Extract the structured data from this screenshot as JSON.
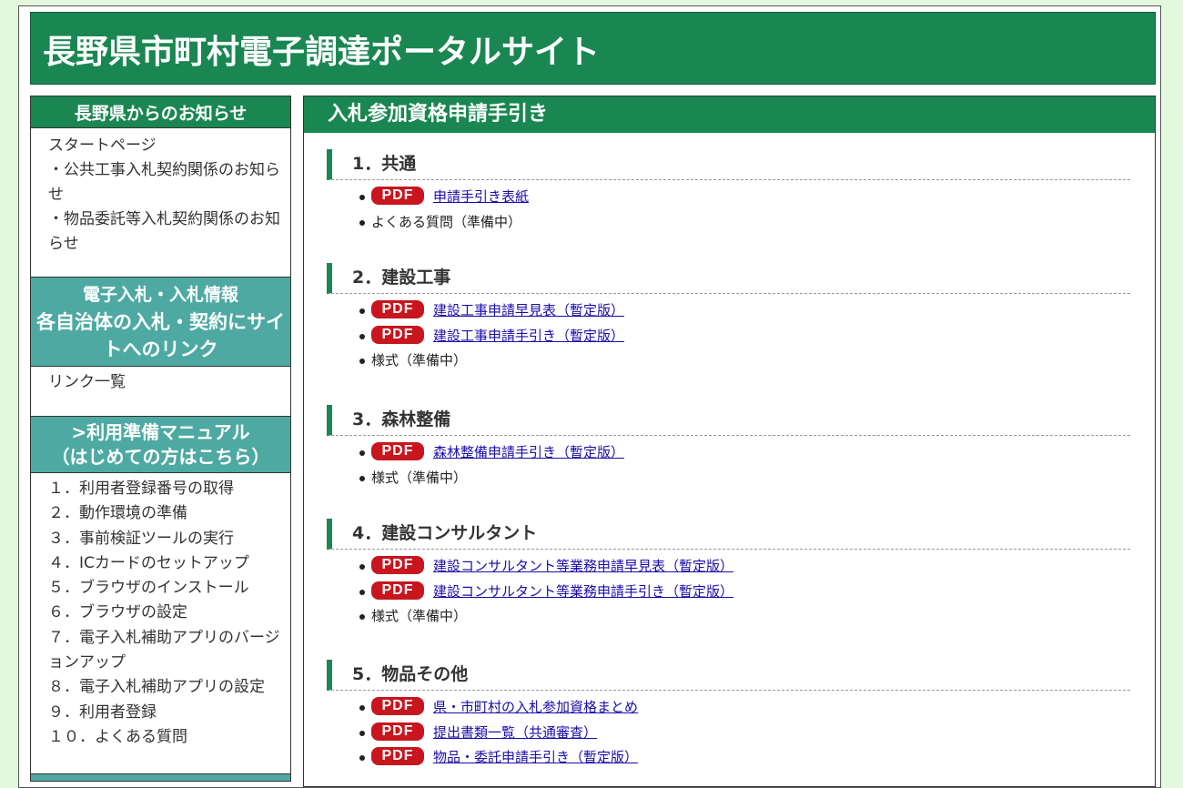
{
  "site_title": "長野県市町村電子調達ポータルサイト",
  "sidebar": {
    "notice": {
      "heading": "長野県からのお知らせ",
      "items": [
        "スタートページ",
        "・公共工事入札契約関係のお知らせ",
        "・物品委託等入札契約関係のお知らせ"
      ]
    },
    "links": {
      "heading_line1": "電子入札・入札情報",
      "heading_line2": "各自治体の入札・契約にサイトへのリンク",
      "items": [
        "リンク一覧"
      ]
    },
    "manual": {
      "heading_line1": ">利用準備マニュアル",
      "heading_line2": "（はじめての方はこちら）",
      "items": [
        "１．利用者登録番号の取得",
        "２．動作環境の準備",
        "３．事前検証ツールの実行",
        "４．ICカードのセットアップ",
        "５．ブラウザのインストール",
        "６．ブラウザの設定",
        "７．電子入札補助アプリのバージョンアップ",
        "８．電子入札補助アプリの設定",
        "９．利用者登録",
        "１０．よくある質問"
      ]
    }
  },
  "main": {
    "heading": "入札参加資格申請手引き",
    "pdf_label": "PDF",
    "sections": [
      {
        "title": "1．共通",
        "items": [
          {
            "pdf": true,
            "text": "申請手引き表紙"
          },
          {
            "pdf": false,
            "text": "よくある質問（準備中）"
          }
        ]
      },
      {
        "title": "2．建設工事",
        "items": [
          {
            "pdf": true,
            "text": "建設工事申請早見表（暫定版）"
          },
          {
            "pdf": true,
            "text": "建設工事申請手引き（暫定版）"
          },
          {
            "pdf": false,
            "text": "様式（準備中）"
          }
        ]
      },
      {
        "title": "3．森林整備",
        "items": [
          {
            "pdf": true,
            "text": "森林整備申請手引き（暫定版）"
          },
          {
            "pdf": false,
            "text": "様式（準備中）"
          }
        ]
      },
      {
        "title": "4．建設コンサルタント",
        "items": [
          {
            "pdf": true,
            "text": "建設コンサルタント等業務申請早見表（暫定版）"
          },
          {
            "pdf": true,
            "text": "建設コンサルタント等業務申請手引き（暫定版）"
          },
          {
            "pdf": false,
            "text": "様式（準備中）"
          }
        ]
      },
      {
        "title": "5．物品その他",
        "items": [
          {
            "pdf": true,
            "text": "県・市町村の入札参加資格まとめ"
          },
          {
            "pdf": true,
            "text": "提出書類一覧（共通審査）"
          },
          {
            "pdf": true,
            "text": "物品・委託申請手引き（暫定版）"
          }
        ]
      }
    ]
  }
}
